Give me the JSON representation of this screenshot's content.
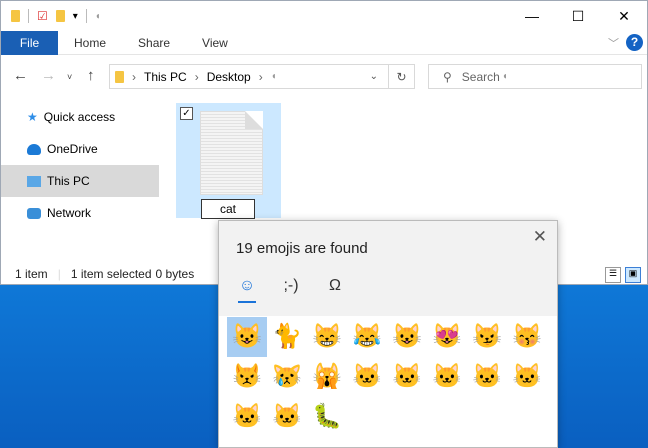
{
  "window": {
    "tabs": [
      "File",
      "Home",
      "Share",
      "View"
    ],
    "help": "?"
  },
  "nav": {
    "breadcrumb": [
      "This PC",
      "Desktop"
    ],
    "search_placeholder": "Search"
  },
  "sidebar": {
    "items": [
      {
        "label": "Quick access",
        "icon": "star-icon"
      },
      {
        "label": "OneDrive",
        "icon": "cloud-icon"
      },
      {
        "label": "This PC",
        "icon": "computer-icon",
        "selected": true
      },
      {
        "label": "Network",
        "icon": "network-icon"
      }
    ]
  },
  "file": {
    "name": "cat",
    "checked": true
  },
  "status": {
    "count": "1 item",
    "selected": "1 item selected",
    "size": "0 bytes"
  },
  "emoji_panel": {
    "title": "19 emojis are found",
    "tabs": [
      "☺",
      ";-)",
      "Ω"
    ],
    "emojis": [
      "😺",
      "🐈",
      "😸",
      "😹",
      "😺",
      "😻",
      "😼",
      "😽",
      "😾",
      "😿",
      "🙀",
      "🐱",
      "🐱",
      "🐱",
      "🐱",
      "🐱",
      "🐱",
      "🐱",
      "🐛"
    ]
  },
  "colors": {
    "accent": "#1a5fb4",
    "selection": "#cce8ff",
    "desktop": "#0a63c9"
  }
}
